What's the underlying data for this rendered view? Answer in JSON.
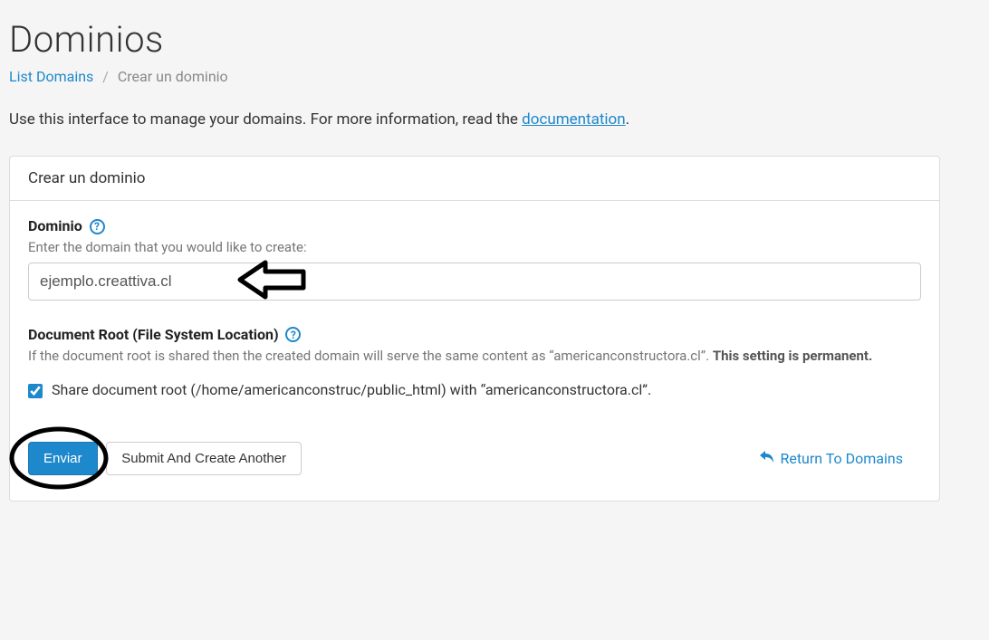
{
  "header": {
    "title": "Dominios",
    "breadcrumb_link": "List Domains",
    "breadcrumb_sep": "/",
    "breadcrumb_current": "Crear un dominio"
  },
  "intro": {
    "text_prefix": "Use this interface to manage your domains. For more information, read the ",
    "doc_link": "documentation",
    "text_suffix": "."
  },
  "panel": {
    "heading": "Crear un dominio"
  },
  "domain": {
    "label": "Dominio",
    "help_glyph": "?",
    "hint": "Enter the domain that you would like to create:",
    "value": "ejemplo.creattiva.cl"
  },
  "docroot": {
    "label": "Document Root (File System Location)",
    "help_glyph": "?",
    "hint_prefix": "If the document root is shared then the created domain will serve the same content as “americanconstructora.cl”. ",
    "hint_strong": "This setting is permanent.",
    "checkbox_label": "Share document root (/home/americanconstruc/public_html) with “americanconstructora.cl”.",
    "checked": true
  },
  "actions": {
    "submit": "Enviar",
    "submit_another": "Submit And Create Another",
    "return": "Return To Domains"
  }
}
